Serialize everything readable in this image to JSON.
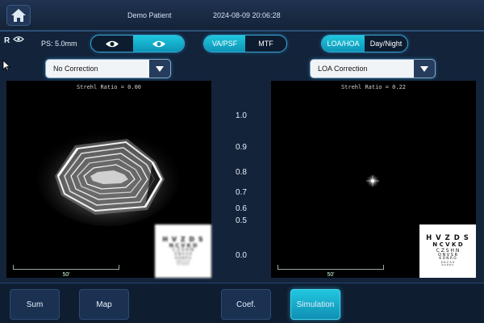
{
  "header": {
    "patient_name": "Demo Patient",
    "datetime": "2024-08-09 20:06:28"
  },
  "eye": {
    "side": "R",
    "pupil_size": "PS: 5.0mm"
  },
  "mode_toggle": {
    "options": [
      "VA/PSF",
      "MTF"
    ],
    "selected": "VA/PSF"
  },
  "aberration_toggle": {
    "options": [
      "LOA/HOA",
      "Day/Night"
    ],
    "selected": "LOA/HOA"
  },
  "left_view": {
    "correction": "No Correction",
    "strehl": "Strehl Ratio = 0.00",
    "scale_label": "50'"
  },
  "right_view": {
    "correction": "LOA Correction",
    "strehl": "Strehl Ratio = 0.22",
    "scale_label": "50'"
  },
  "eye_chart": {
    "rows": [
      "H V Z D S",
      "N C V K D",
      "C Z S H N",
      "O N V S R",
      "K D N R O",
      "Z K C S V",
      "D V O H C"
    ]
  },
  "va_scale": [
    "1.0",
    "0.9",
    "0.8",
    "0.7",
    "0.6",
    "0.5",
    "0.0"
  ],
  "bottom_tabs": [
    {
      "label": "Sum",
      "active": false
    },
    {
      "label": "Map",
      "active": false
    },
    {
      "label": "Coef.",
      "active": false
    },
    {
      "label": "Simulation",
      "active": true
    }
  ],
  "colors": {
    "accent": "#1ec7dc",
    "background": "#0b1526",
    "panel": "#13233a"
  }
}
